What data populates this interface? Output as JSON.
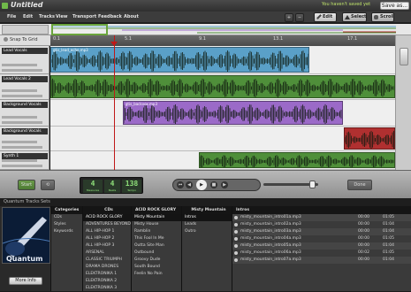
{
  "window": {
    "title": "Untitled",
    "unsaved_text": "You haven't saved yet",
    "save_as": "Save as..."
  },
  "menu": [
    "File",
    "Edit",
    "Tracks",
    "View",
    "Transport",
    "Feedback",
    "About"
  ],
  "toolbar": {
    "edit": "Edit",
    "select": "Select",
    "scroll": "Scroll"
  },
  "snap_label": "Snap To Grid",
  "ruler": [
    "0.1",
    "5.1",
    "9.1",
    "13.1",
    "17.1"
  ],
  "tracks": [
    {
      "name": "Lead Vocals",
      "color": "#5aa0c8",
      "clips": [
        {
          "label": "gtis_lead_echo.mp3",
          "start": 0,
          "end": 0.75
        }
      ]
    },
    {
      "name": "Lead Vocals 2",
      "color": "#4f8f3a",
      "clips": [
        {
          "label": "",
          "start": 0,
          "end": 1
        }
      ]
    },
    {
      "name": "Background Vocals",
      "color": "#9b6ac8",
      "clips": [
        {
          "label": "gtis_backvox.mp3",
          "start": 0.21,
          "end": 0.85
        }
      ]
    },
    {
      "name": "Background Vocals",
      "color": "#b03030",
      "clips": [
        {
          "label": "",
          "start": 0.85,
          "end": 1
        }
      ]
    },
    {
      "name": "Synth 1",
      "color": "#4f8f3a",
      "clips": [
        {
          "label": "",
          "start": 0.43,
          "end": 1
        }
      ]
    }
  ],
  "transport": {
    "left_btn": "Start",
    "tempo": "4",
    "beats": "4",
    "bpm": "138",
    "tempo_cap": "Measures",
    "beats_cap": "Beats",
    "bpm_cap": "Tempo",
    "right_btn": "Done"
  },
  "browser": {
    "tabs": [
      "Quantum Tracks",
      "Sets"
    ],
    "more_info": "More Info",
    "categories": {
      "header": "Categories",
      "items": [
        "CDs",
        "Styles",
        "Keywords"
      ]
    },
    "cds": {
      "header": "CDs",
      "items": [
        "ACID ROCK GLORY",
        "ADVENTURES BEYOND",
        "ALL HIP-HOP 1",
        "ALL HIP-HOP 2",
        "ALL HIP-HOP 3",
        "ARSENAL",
        "CLASSIC TRIUMPH",
        "DRAMA DRONES",
        "ELEKTRONIKA 1",
        "ELEKTRONIKA 2",
        "ELEKTRONIKA 3"
      ],
      "selected": 0
    },
    "acid": {
      "header": "ACID ROCK GLORY",
      "items": [
        "Misty Mountain",
        "Misty House",
        "Ramblin",
        "This Fool In Me",
        "Outta Site Man",
        "Outbound",
        "Groovy Dude",
        "South Bound",
        "Feelin No Pain"
      ],
      "selected": 0
    },
    "misty": {
      "header": "Misty Mountain",
      "items": [
        "Intros",
        "Leads",
        "Outro"
      ],
      "selected": 0
    },
    "files": {
      "header": "Intros",
      "items": [
        {
          "name": "misty_mountain_intro01a.mp3",
          "dur": "00:00",
          "bar": "01:05"
        },
        {
          "name": "misty_mountain_intro02a.mp3",
          "dur": "00:00",
          "bar": "01:04"
        },
        {
          "name": "misty_mountain_intro03a.mp3",
          "dur": "00:00",
          "bar": "01:04"
        },
        {
          "name": "misty_mountain_intro04a.mp3",
          "dur": "00:00",
          "bar": "01:05"
        },
        {
          "name": "misty_mountain_intro05a.mp3",
          "dur": "00:00",
          "bar": "01:04"
        },
        {
          "name": "misty_mountain_intro06a.mp3",
          "dur": "00:02",
          "bar": "01:05"
        },
        {
          "name": "misty_mountain_intro07a.mp3",
          "dur": "00:00",
          "bar": "01:04"
        }
      ]
    }
  }
}
